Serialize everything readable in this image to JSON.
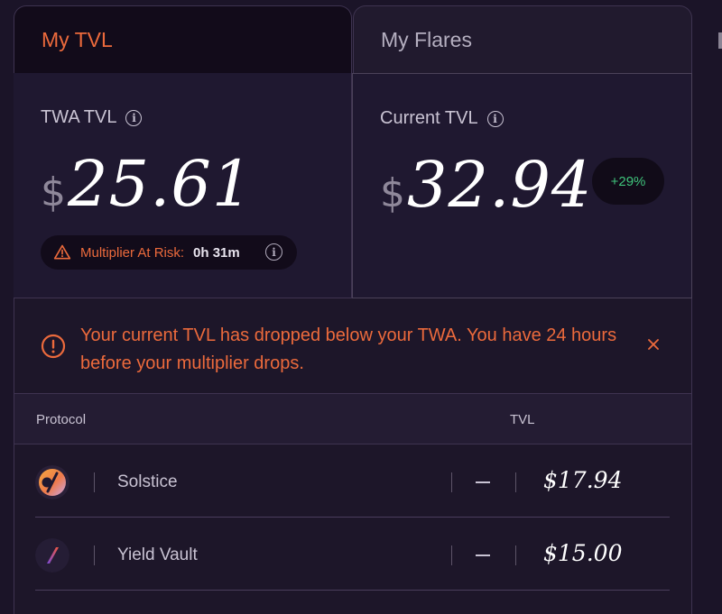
{
  "tabs": {
    "active_label": "My TVL",
    "inactive_label": "My Flares"
  },
  "twa_card": {
    "title": "TWA TVL",
    "currency_symbol": "$",
    "value": "25.61",
    "risk": {
      "label": "Multiplier At Risk:",
      "hours": "0",
      "hours_unit": "h",
      "minutes": "31",
      "minutes_unit": "m"
    }
  },
  "current_card": {
    "title": "Current TVL",
    "currency_symbol": "$",
    "value": "32.94",
    "change": "+29%"
  },
  "alert": {
    "message": "Your current TVL has dropped below your TWA. You have 24 hours before your multiplier drops."
  },
  "table": {
    "headers": {
      "protocol": "Protocol",
      "tvl": "TVL"
    },
    "rows": [
      {
        "name": "Solstice",
        "change": "",
        "tvl": "$17.94",
        "icon": "solstice-logo-icon"
      },
      {
        "name": "Yield Vault",
        "change": "",
        "tvl": "$15.00",
        "icon": "yield-vault-logo-icon"
      }
    ]
  },
  "colors": {
    "accent": "#ec6a3c",
    "positive": "#3fc37b",
    "background": "#1b1428"
  }
}
